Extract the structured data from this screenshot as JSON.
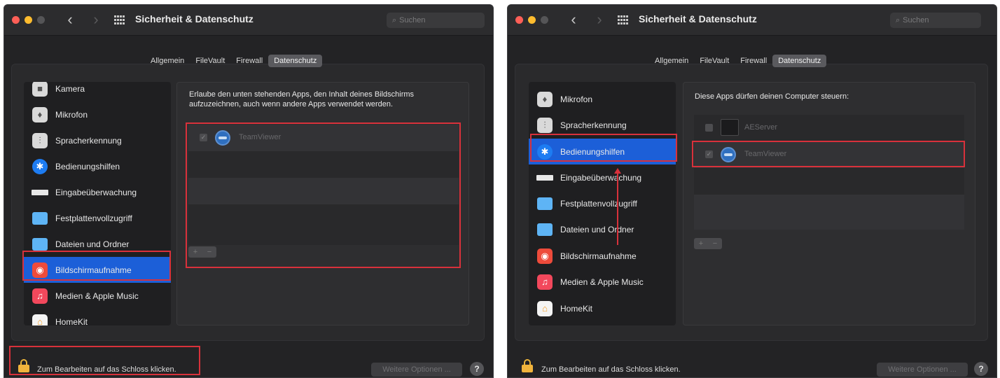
{
  "window": {
    "title": "Sicherheit & Datenschutz",
    "search_placeholder": "Suchen"
  },
  "tabs": [
    "Allgemein",
    "FileVault",
    "Firewall",
    "Datenschutz"
  ],
  "active_tab": "Datenschutz",
  "left": {
    "sidebar": [
      {
        "label": "Kamera",
        "icon": "camera-icon"
      },
      {
        "label": "Mikrofon",
        "icon": "microphone-icon"
      },
      {
        "label": "Spracherkennung",
        "icon": "waveform-icon"
      },
      {
        "label": "Bedienungshilfen",
        "icon": "accessibility-icon"
      },
      {
        "label": "Eingabeüberwachung",
        "icon": "keyboard-icon"
      },
      {
        "label": "Festplattenvollzugriff",
        "icon": "folder-icon"
      },
      {
        "label": "Dateien und Ordner",
        "icon": "folder-icon"
      },
      {
        "label": "Bildschirmaufnahme",
        "icon": "screen-record-icon",
        "selected": true
      },
      {
        "label": "Medien & Apple Music",
        "icon": "music-icon"
      },
      {
        "label": "HomeKit",
        "icon": "home-icon"
      }
    ],
    "description": "Erlaube den unten stehenden Apps, den Inhalt deines Bildschirms aufzuzeichnen, auch wenn andere Apps verwendet werden.",
    "apps": [
      {
        "name": "TeamViewer",
        "checked": true
      }
    ]
  },
  "right": {
    "sidebar": [
      {
        "label": "Mikrofon",
        "icon": "microphone-icon"
      },
      {
        "label": "Spracherkennung",
        "icon": "waveform-icon"
      },
      {
        "label": "Bedienungshilfen",
        "icon": "accessibility-icon",
        "selected": true
      },
      {
        "label": "Eingabeüberwachung",
        "icon": "keyboard-icon"
      },
      {
        "label": "Festplattenvollzugriff",
        "icon": "folder-icon"
      },
      {
        "label": "Dateien und Ordner",
        "icon": "folder-icon"
      },
      {
        "label": "Bildschirmaufnahme",
        "icon": "screen-record-icon"
      },
      {
        "label": "Medien & Apple Music",
        "icon": "music-icon"
      },
      {
        "label": "HomeKit",
        "icon": "home-icon"
      }
    ],
    "description": "Diese Apps dürfen deinen Computer steuern:",
    "apps": [
      {
        "name": "AEServer",
        "checked": false
      },
      {
        "name": "TeamViewer",
        "checked": true
      }
    ]
  },
  "footer": {
    "lock_text": "Zum Bearbeiten auf das Schloss klicken.",
    "more_options": "Weitere Optionen ...",
    "help": "?"
  },
  "list_controls": {
    "plus": "+",
    "minus": "−"
  },
  "colors": {
    "highlight": "#d8313b",
    "selection": "#1c5fd8"
  }
}
